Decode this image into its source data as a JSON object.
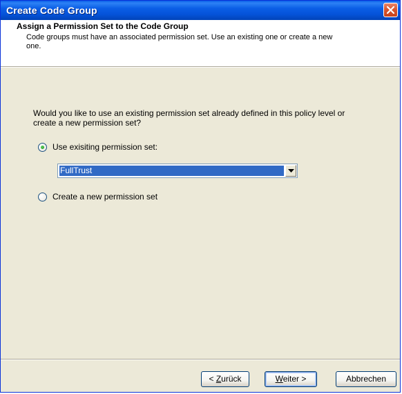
{
  "window": {
    "title": "Create Code Group",
    "close_icon": "close-icon"
  },
  "header": {
    "title": "Assign a Permission Set to the Code Group",
    "description": "Code groups must have an associated permission set. Use an existing one or create a new one."
  },
  "main": {
    "question": "Would you like to use an existing permission set already defined in this policy level or create a new permission set?",
    "options": [
      {
        "label": "Use exisiting permission set:",
        "selected": true
      },
      {
        "label": "Create a new permission set",
        "selected": false
      }
    ],
    "permission_set_select": {
      "value": "FullTrust"
    }
  },
  "footer": {
    "back": {
      "prefix": "< ",
      "accel": "Z",
      "rest": "urück"
    },
    "next": {
      "accel": "W",
      "rest": "eiter >"
    },
    "cancel": {
      "label": "Abbrechen"
    }
  },
  "colors": {
    "titlebar": "#0553d9",
    "selection": "#316ac5",
    "dialog_bg": "#ece9d8"
  }
}
